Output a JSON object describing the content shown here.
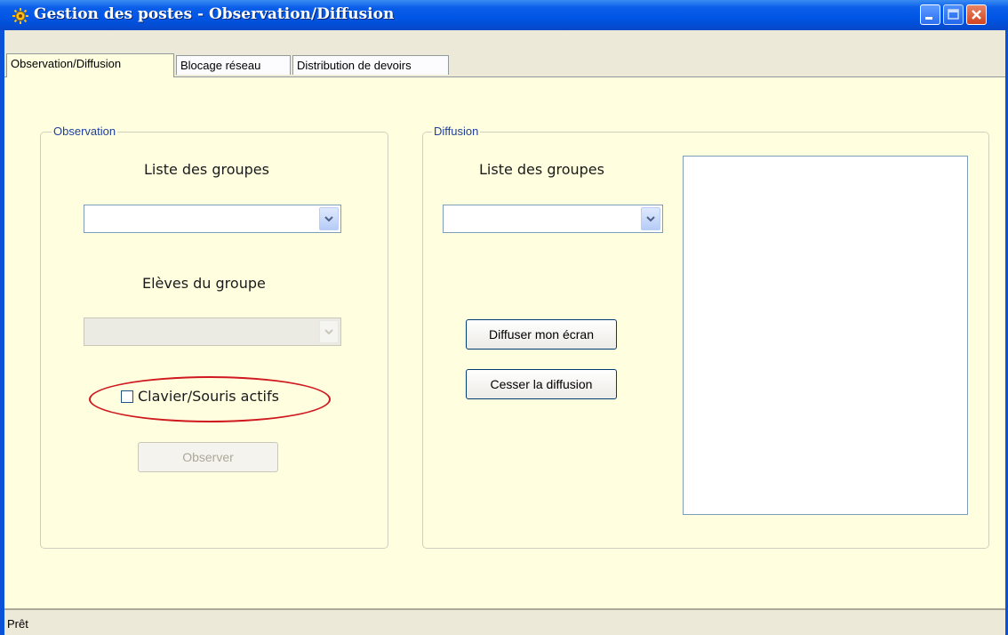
{
  "window": {
    "title": "Gestion des postes - Observation/Diffusion",
    "icon": "gear-sun-icon"
  },
  "tabs": [
    {
      "label": "Observation/Diffusion",
      "active": true
    },
    {
      "label": "Blocage réseau",
      "active": false
    },
    {
      "label": "Distribution de devoirs",
      "active": false
    }
  ],
  "observation": {
    "legend": "Observation",
    "groups_label": "Liste des groupes",
    "groups_value": "",
    "students_label": "Elèves du groupe",
    "students_value": "",
    "checkbox_label": "Clavier/Souris actifs",
    "checkbox_checked": false,
    "observe_button": "Observer"
  },
  "diffusion": {
    "legend": "Diffusion",
    "groups_label": "Liste des groupes",
    "groups_value": "",
    "broadcast_button": "Diffuser mon écran",
    "stop_button": "Cesser la diffusion"
  },
  "status": {
    "text": "Prêt"
  },
  "colors": {
    "panel_background": "#ffffe0",
    "titlebar": "#0055e5",
    "annotation": "#d0181f"
  }
}
